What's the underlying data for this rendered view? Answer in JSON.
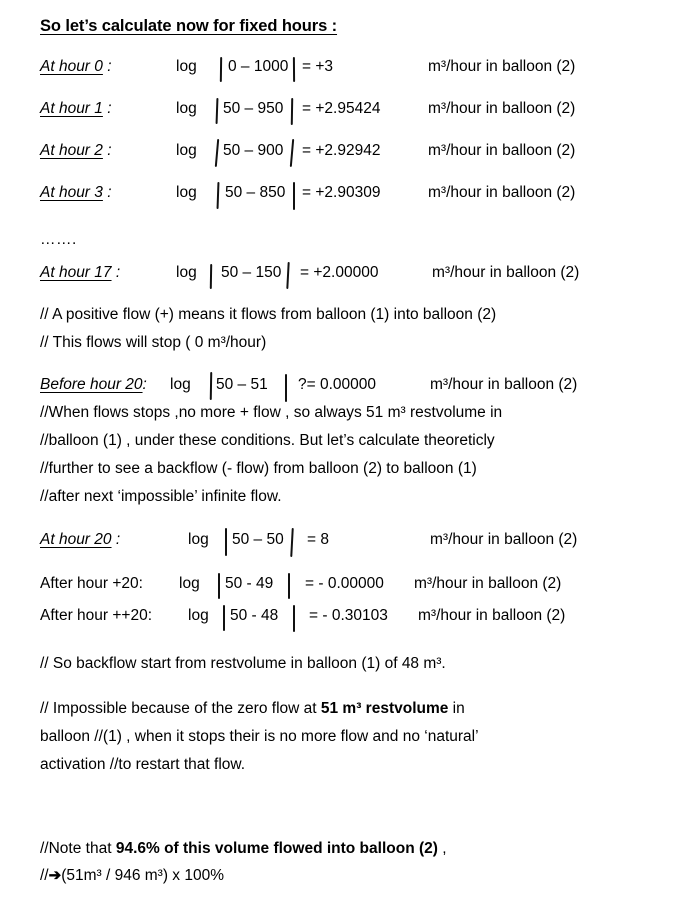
{
  "document": {
    "title": "So let’s calculate now for fixed hours :",
    "unit_label": "m³/hour in balloon (2)",
    "log_word": "log"
  },
  "calculations": [
    {
      "label": "At  hour 0",
      "label_suffix": " :",
      "log": "log",
      "expr": "0 – 1000",
      "result": "= +3",
      "unit": "m³/hour in balloon (2)"
    },
    {
      "label": "At  hour 1",
      "label_suffix": " :",
      "log": "log",
      "expr": "50 – 950",
      "result": "= +2.95424",
      "unit": "m³/hour in balloon (2)"
    },
    {
      "label": "At hour 2",
      "label_suffix": " :",
      "log": "log",
      "expr": "50 – 900",
      "result": "= +2.92942",
      "unit": "m³/hour in balloon (2)"
    },
    {
      "label": "At hour 3",
      "label_suffix": " :",
      "log": "log",
      "expr": "50 – 850",
      "result": "= +2.90309",
      "unit": "m³/hour in balloon (2)"
    },
    {
      "label": "At hour 17",
      "label_suffix": " :",
      "log": "log",
      "expr": "50 – 150",
      "result": "= +2.00000",
      "unit": "m³/hour in balloon (2)"
    },
    {
      "label": "Before hour 20",
      "label_suffix": ":",
      "log": "log",
      "expr": "50 – 51",
      "result": "?=  0.00000",
      "unit": "m³/hour in balloon (2)"
    },
    {
      "label": "At hour 20",
      "label_suffix": " :",
      "log": "log",
      "expr": "50 – 50",
      "result": "= 8",
      "unit": "m³/hour in balloon (2)"
    },
    {
      "label": "After hour +20:",
      "label_suffix": "",
      "log": "log",
      "expr": "50  - 49",
      "result": "= - 0.00000",
      "unit": "m³/hour in balloon (2)"
    },
    {
      "label": "After hour ++20:",
      "label_suffix": "",
      "log": "log",
      "expr": "50  - 48",
      "result": "= - 0.30103",
      "unit": "m³/hour in balloon (2)"
    }
  ],
  "ellipsis": "…….",
  "notes": {
    "positive_flow": "// A positive flow (+) means it flows from balloon (1) into balloon (2)",
    "flow_stops": "// This flows will stop ( 0 m³/hour)",
    "when_stops_1": "//When flows stops ,no more + flow , so always 51 m³ restvolume in",
    "when_stops_2": "//balloon (1) , under these conditions. But let’s calculate theoreticly",
    "when_stops_3": "//further to see a backflow (- flow) from balloon (2) to balloon (1)",
    "when_stops_4": "//after next ‘impossible’ infinite flow.",
    "backflow_start": "// So backflow start from restvolume in balloon (1) of 48 m³.",
    "impossible_1_pre": "// Impossible because of the zero flow at ",
    "impossible_1_bold": "51 m³ restvolume",
    "impossible_1_post": " in",
    "impossible_2": "balloon //(1) , when it stops their is no more flow and no ‘natural’",
    "impossible_3": "activation //to restart that flow.",
    "note_pre": "//Note that ",
    "note_bold": "94.6% of this volume flowed into balloon (2)",
    "note_post": " ,",
    "note_formula_prefix": "//",
    "note_formula_arrow": "➔",
    "note_formula": "(51m³ / 946 m³) x 100%"
  }
}
